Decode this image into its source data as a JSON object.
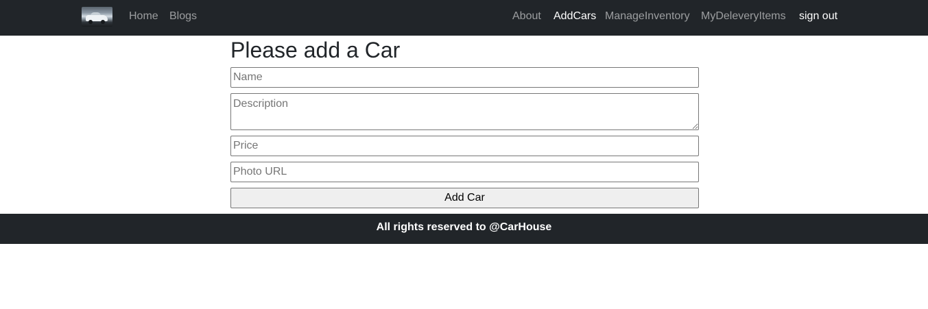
{
  "nav": {
    "logo_icon": "car-logo-icon",
    "links_left": [
      {
        "label": "Home"
      },
      {
        "label": "Blogs"
      }
    ],
    "links_right": [
      {
        "label": "About"
      },
      {
        "label": "AddCars",
        "active": true
      },
      {
        "label": "ManageInventory"
      },
      {
        "label": "MyDeleveryItems"
      }
    ],
    "signout_label": "sign out"
  },
  "form": {
    "title": "Please add a Car",
    "name_placeholder": "Name",
    "description_placeholder": "Description",
    "price_placeholder": "Price",
    "photo_placeholder": "Photo URL",
    "submit_label": "Add Car"
  },
  "footer": {
    "text": "All rights reserved to @CarHouse"
  },
  "colors": {
    "navbar_bg": "#212529",
    "footer_bg": "#212529",
    "nav_link": "#8c8e91",
    "nav_link_active": "#ffffff",
    "button_bg": "#efefef"
  }
}
